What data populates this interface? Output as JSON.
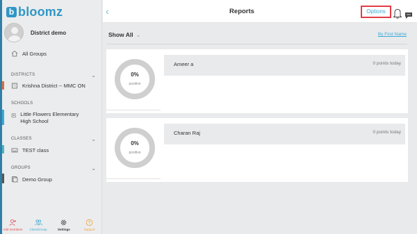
{
  "app": {
    "logo": "b",
    "name": "bloomz"
  },
  "profile": {
    "name": "District demo"
  },
  "sidebar": {
    "all_groups": "All Groups",
    "sections": [
      {
        "label": "DISTRICTS",
        "items": [
          "Krishna District -- MMC ON"
        ]
      },
      {
        "label": "SCHOOLS",
        "items": [
          "Little Flowers Elementary High School"
        ]
      },
      {
        "label": "CLASSES",
        "items": [
          "TEST class"
        ]
      },
      {
        "label": "GROUPS",
        "items": [
          "Demo Group"
        ]
      }
    ],
    "bottom": [
      {
        "label": "Add members",
        "color": "#e0464e"
      },
      {
        "label": "Class/Group",
        "color": "#3aa9d4"
      },
      {
        "label": "Settings",
        "color": "#333333"
      },
      {
        "label": "Support",
        "color": "#f0a23a"
      }
    ]
  },
  "header": {
    "title": "Reports",
    "options": "Options",
    "back_icon": "chevron-left-icon"
  },
  "filter": {
    "show": "Show All",
    "sort": "By First Name"
  },
  "reports": [
    {
      "percent": "0%",
      "label": "positive",
      "name": "Ameer a",
      "points": "0 points today"
    },
    {
      "percent": "0%",
      "label": "positive",
      "name": "Charan Raj",
      "points": "0 points today"
    }
  ],
  "colors": {
    "accent": "#3aa9d4",
    "highlight": "#e23b44",
    "district_bar": "#e26b3a",
    "school_bar": "#3aa9d4",
    "class_bar": "#49b8c4",
    "group_bar": "#555555"
  }
}
